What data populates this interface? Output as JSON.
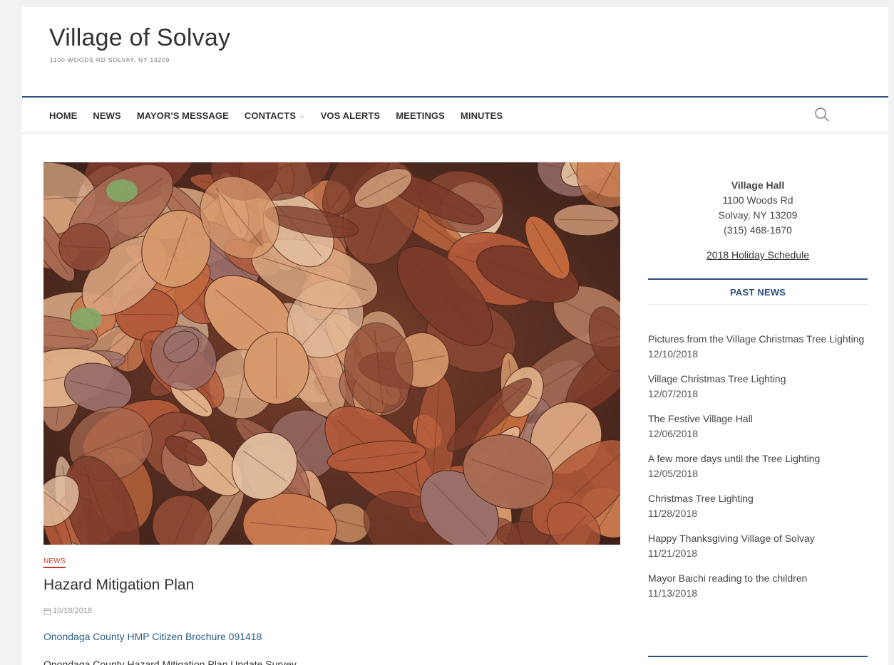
{
  "site": {
    "title": "Village of Solvay",
    "tagline": "1100 WOODS RD SOLVAY, NY 13209"
  },
  "nav": {
    "items": [
      "HOME",
      "NEWS",
      "MAYOR'S MESSAGE",
      "CONTACTS",
      "VOS ALERTS",
      "MEETINGS",
      "MINUTES"
    ],
    "search_icon": "search-icon"
  },
  "post": {
    "category": "NEWS",
    "title": "Hazard Mitigation Plan",
    "date": "10/18/2018",
    "link_text": "Onondaga County HMP Citizen Brochure 091418",
    "next_line": "Onondaga County Hazard Mitigation Plan Update Survey"
  },
  "sidebar": {
    "hall_name": "Village Hall",
    "address1": "1100 Woods Rd",
    "address2": "Solvay, NY 13209",
    "phone": "(315) 468-1670",
    "schedule_link": "2018 Holiday Schedule",
    "past_news_heading": "PAST NEWS",
    "news": [
      {
        "title": "Pictures from the Village Christmas Tree Lighting",
        "date": "12/10/2018"
      },
      {
        "title": "Village Christmas Tree Lighting",
        "date": "12/07/2018"
      },
      {
        "title": "The Festive Village Hall",
        "date": "12/06/2018"
      },
      {
        "title": "A few more days until the Tree Lighting",
        "date": "12/05/2018"
      },
      {
        "title": "Christmas Tree Lighting",
        "date": "11/28/2018"
      },
      {
        "title": "Happy Thanksgiving Village of Solvay",
        "date": "11/21/2018"
      },
      {
        "title": "Mayor Baichi reading to the children",
        "date": "11/13/2018"
      }
    ]
  },
  "colors": {
    "accent": "#2f4f7f",
    "category": "#c0392b",
    "link": "#2b5d86"
  }
}
